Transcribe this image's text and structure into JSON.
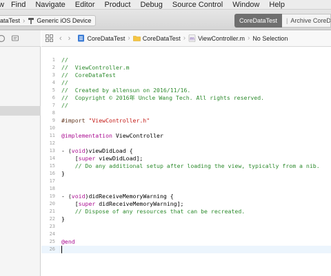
{
  "menu": [
    "w",
    "Find",
    "Navigate",
    "Editor",
    "Product",
    "Debug",
    "Source Control",
    "Window",
    "Help"
  ],
  "toolbar": {
    "scheme": "ataTest",
    "destination": "Generic iOS Device",
    "project": "CoreDataTest",
    "status": "Archive CoreDataTest"
  },
  "jumpbar": {
    "project": "CoreDataTest",
    "group": "CoreDataTest",
    "file": "ViewController.m",
    "selection": "No Selection"
  },
  "editor": {
    "current_line": 26,
    "lines": [
      {
        "n": "1",
        "segs": [
          {
            "t": "//",
            "c": "comment"
          }
        ]
      },
      {
        "n": "2",
        "segs": [
          {
            "t": "//  ViewController.m",
            "c": "comment"
          }
        ]
      },
      {
        "n": "3",
        "segs": [
          {
            "t": "//  CoreDataTest",
            "c": "comment"
          }
        ]
      },
      {
        "n": "4",
        "segs": [
          {
            "t": "//",
            "c": "comment"
          }
        ]
      },
      {
        "n": "5",
        "segs": [
          {
            "t": "//  Created by allensun on 2016/11/16.",
            "c": "comment"
          }
        ]
      },
      {
        "n": "6",
        "segs": [
          {
            "t": "//  Copyright © 2016年 Uncle Wang Tech. All rights reserved.",
            "c": "comment"
          }
        ]
      },
      {
        "n": "7",
        "segs": [
          {
            "t": "//",
            "c": "comment"
          }
        ]
      },
      {
        "n": "8",
        "segs": []
      },
      {
        "n": "9",
        "segs": [
          {
            "t": "#import ",
            "c": "directive"
          },
          {
            "t": "\"ViewController.h\"",
            "c": "string"
          }
        ]
      },
      {
        "n": "10",
        "segs": []
      },
      {
        "n": "11",
        "segs": [
          {
            "t": "@implementation",
            "c": "keyword"
          },
          {
            "t": " ViewController",
            "c": "plain"
          }
        ]
      },
      {
        "n": "12",
        "segs": []
      },
      {
        "n": "13",
        "segs": [
          {
            "t": "- (",
            "c": "plain"
          },
          {
            "t": "void",
            "c": "keyword"
          },
          {
            "t": ")viewDidLoad {",
            "c": "plain"
          }
        ]
      },
      {
        "n": "14",
        "segs": [
          {
            "t": "    [",
            "c": "plain"
          },
          {
            "t": "super",
            "c": "keyword"
          },
          {
            "t": " viewDidLoad];",
            "c": "plain"
          }
        ]
      },
      {
        "n": "15",
        "segs": [
          {
            "t": "    // Do any additional setup after loading the view, typically from a nib.",
            "c": "comment"
          }
        ]
      },
      {
        "n": "16",
        "segs": [
          {
            "t": "}",
            "c": "plain"
          }
        ]
      },
      {
        "n": "17",
        "segs": []
      },
      {
        "n": "18",
        "segs": []
      },
      {
        "n": "19",
        "segs": [
          {
            "t": "- (",
            "c": "plain"
          },
          {
            "t": "void",
            "c": "keyword"
          },
          {
            "t": ")didReceiveMemoryWarning {",
            "c": "plain"
          }
        ]
      },
      {
        "n": "20",
        "segs": [
          {
            "t": "    [",
            "c": "plain"
          },
          {
            "t": "super",
            "c": "keyword"
          },
          {
            "t": " didReceiveMemoryWarning];",
            "c": "plain"
          }
        ]
      },
      {
        "n": "21",
        "segs": [
          {
            "t": "    // Dispose of any resources that can be recreated.",
            "c": "comment"
          }
        ]
      },
      {
        "n": "22",
        "segs": [
          {
            "t": "}",
            "c": "plain"
          }
        ]
      },
      {
        "n": "23",
        "segs": []
      },
      {
        "n": "24",
        "segs": []
      },
      {
        "n": "25",
        "segs": [
          {
            "t": "@end",
            "c": "keyword"
          }
        ]
      },
      {
        "n": "26",
        "segs": []
      }
    ]
  }
}
